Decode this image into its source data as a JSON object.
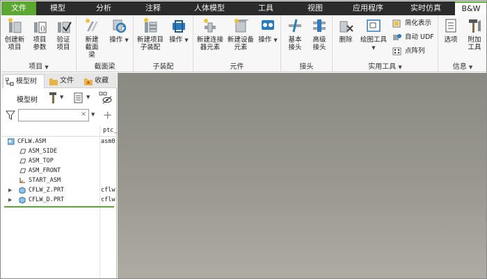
{
  "menu": {
    "tabs": [
      "文件",
      "模型",
      "分析",
      "注释",
      "人体模型",
      "工具",
      "视图",
      "应用程序",
      "实时仿真",
      "B&W AFX"
    ]
  },
  "ribbon": {
    "groups": {
      "project": {
        "label": "项目",
        "buttons": [
          "创建新项目",
          "项目参数",
          "验证项目"
        ]
      },
      "section_beam": {
        "label": "截面梁",
        "buttons": [
          "新建截面梁",
          "操作"
        ]
      },
      "sub_assembly": {
        "label": "子装配",
        "buttons": [
          "新建项目子装配",
          "操作"
        ]
      },
      "components": {
        "label": "元件",
        "buttons": [
          "新建连接器元素",
          "新建设备元素",
          "操作"
        ]
      },
      "joints": {
        "label": "接头",
        "buttons": [
          "基本接头",
          "高级接头"
        ]
      },
      "utilities": {
        "label": "实用工具",
        "buttons": [
          "删除",
          "绘图工具"
        ],
        "small_buttons": [
          "简化表示",
          "自动 UDF",
          "点阵列"
        ]
      },
      "info": {
        "label": "信息",
        "buttons": [
          "选项",
          "附加工具"
        ]
      }
    }
  },
  "panel": {
    "tabs": [
      "模型树",
      "文件",
      "收藏"
    ],
    "toolbar_title": "模型树",
    "search_placeholder": "",
    "column_header": "ptc_",
    "tree": [
      {
        "name": "CFLW.ASM",
        "col2": "asm0"
      },
      {
        "name": "ASM_SIDE",
        "col2": ""
      },
      {
        "name": "ASM_TOP",
        "col2": ""
      },
      {
        "name": "ASM_FRONT",
        "col2": ""
      },
      {
        "name": "START_ASM",
        "col2": ""
      },
      {
        "name": "CFLW_Z.PRT",
        "col2": "cflw"
      },
      {
        "name": "CFLW_D.PRT",
        "col2": "cflw"
      }
    ]
  },
  "colors": {
    "accent": "#5aa832",
    "menubar": "#2b2b2b",
    "ribbon": "#f7f7f7",
    "graphics": "#9a988f"
  }
}
